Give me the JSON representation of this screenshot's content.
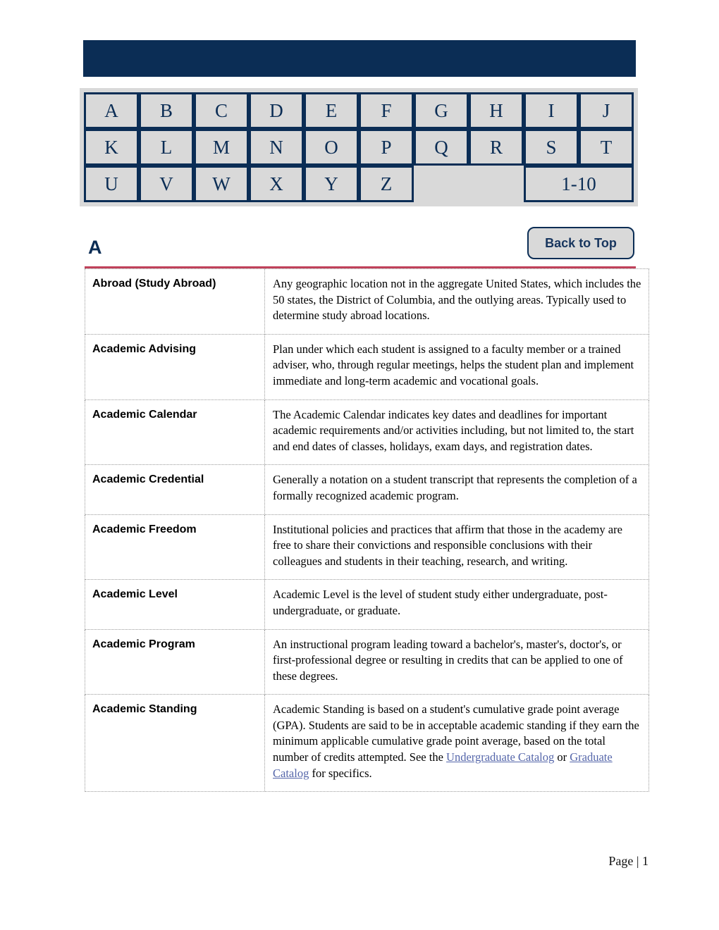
{
  "header": {
    "banner_color": "#0b2d55"
  },
  "alpha_nav": {
    "rows": [
      [
        {
          "label": "A",
          "type": "letter"
        },
        {
          "label": "B",
          "type": "letter"
        },
        {
          "label": "C",
          "type": "letter"
        },
        {
          "label": "D",
          "type": "letter"
        },
        {
          "label": "E",
          "type": "letter"
        },
        {
          "label": "F",
          "type": "letter"
        },
        {
          "label": "G",
          "type": "letter"
        },
        {
          "label": "H",
          "type": "letter"
        },
        {
          "label": "I",
          "type": "letter"
        },
        {
          "label": "J",
          "type": "letter"
        }
      ],
      [
        {
          "label": "K",
          "type": "letter"
        },
        {
          "label": "L",
          "type": "letter"
        },
        {
          "label": "M",
          "type": "letter"
        },
        {
          "label": "N",
          "type": "letter"
        },
        {
          "label": "O",
          "type": "letter"
        },
        {
          "label": "P",
          "type": "letter"
        },
        {
          "label": "Q",
          "type": "letter"
        },
        {
          "label": "R",
          "type": "letter"
        },
        {
          "label": "S",
          "type": "letter"
        },
        {
          "label": "T",
          "type": "letter"
        }
      ],
      [
        {
          "label": "U",
          "type": "letter"
        },
        {
          "label": "V",
          "type": "letter"
        },
        {
          "label": "W",
          "type": "letter"
        },
        {
          "label": "X",
          "type": "letter"
        },
        {
          "label": "Y",
          "type": "letter"
        },
        {
          "label": "Z",
          "type": "letter"
        },
        {
          "label": "",
          "type": "blank",
          "colspan": 2
        },
        {
          "label": "1-10",
          "type": "range",
          "colspan": 2
        }
      ]
    ],
    "cell_bg": "#d9d9d9",
    "border_color": "#0b2d55"
  },
  "section": {
    "letter": "A",
    "back_to_top_label": "Back to Top",
    "rule_color": "#c0415a"
  },
  "glossary": {
    "rows": [
      {
        "term": "Abroad (Study Abroad)",
        "definition": "Any geographic location not in the aggregate United States, which includes the 50 states, the District of Columbia, and the outlying areas.  Typically used to determine study abroad locations."
      },
      {
        "term": "Academic Advising",
        "definition": "Plan under which each student is assigned to a faculty member or a trained adviser, who, through regular meetings, helps the student plan and implement immediate and long-term academic and vocational goals."
      },
      {
        "term": "Academic Calendar",
        "definition": "The Academic Calendar indicates key dates and deadlines for important academic requirements and/or activities including, but not limited to, the start and end dates of classes, holidays, exam days, and registration dates."
      },
      {
        "term": "Academic Credential",
        "definition": "Generally a notation on a student transcript that represents the completion of a formally recognized academic program."
      },
      {
        "term": "Academic Freedom",
        "definition": "Institutional policies and practices that affirm that those in the academy are free to share their convictions and responsible conclusions with their colleagues and students in their teaching, research, and writing."
      },
      {
        "term": "Academic Level",
        "definition": "Academic Level is the level of student study either undergraduate, post-undergraduate, or graduate."
      },
      {
        "term": "Academic Program",
        "definition": "An instructional program leading toward a bachelor's, master's, doctor's, or first-professional degree or resulting in credits that can be applied to one of these degrees."
      },
      {
        "term": "Academic Standing",
        "definition_parts": [
          {
            "text": "Academic Standing is based on a student's cumulative grade point average (GPA).  Students are said to be in acceptable academic standing if they earn the minimum applicable cumulative grade point average, based on the total number of credits attempted.  See the ",
            "link": false
          },
          {
            "text": "Undergraduate Catalog",
            "link": true
          },
          {
            "text": " or ",
            "link": false
          },
          {
            "text": "Graduate Catalog",
            "link": true
          },
          {
            "text": " for specifics.",
            "link": false
          }
        ]
      }
    ],
    "link_color": "#5566aa"
  },
  "footer": {
    "page_label": "Page | 1"
  }
}
